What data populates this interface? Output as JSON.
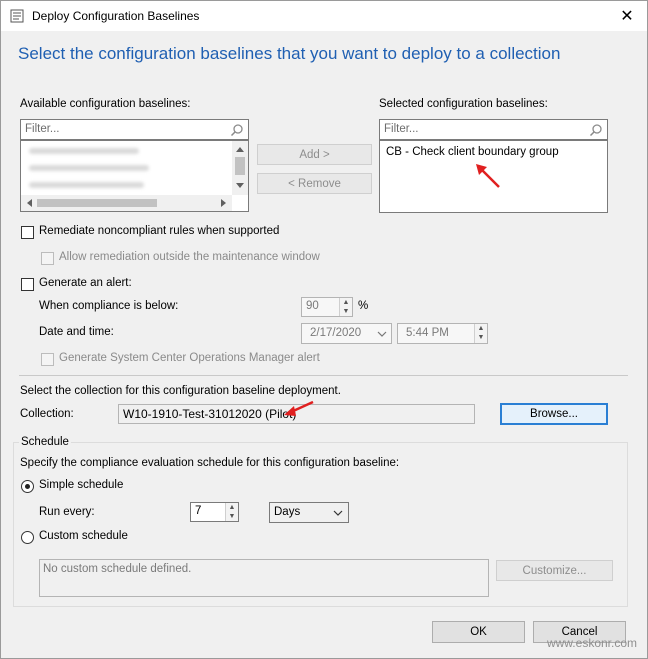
{
  "window": {
    "title": "Deploy Configuration Baselines",
    "close_glyph": "✕"
  },
  "heading": "Select the configuration baselines that you want to deploy to a collection",
  "available": {
    "label": "Available configuration baselines:",
    "filter_placeholder": "Filter..."
  },
  "selected": {
    "label": "Selected configuration baselines:",
    "filter_placeholder": "Filter...",
    "items": [
      "CB - Check client boundary group"
    ]
  },
  "buttons": {
    "add": "Add >",
    "remove": "< Remove",
    "browse": "Browse...",
    "customize": "Customize...",
    "ok": "OK",
    "cancel": "Cancel"
  },
  "options": {
    "remediate": "Remediate noncompliant rules when supported",
    "allow_remediation": "Allow remediation outside the maintenance window",
    "generate_alert": "Generate an alert:",
    "compliance_below_label": "When compliance is below:",
    "compliance_value": "90",
    "percent": "%",
    "date_time_label": "Date and time:",
    "date_value": "2/17/2020",
    "time_value": "5:44 PM",
    "scom_alert": "Generate System Center Operations Manager alert"
  },
  "collection": {
    "prompt": "Select the collection for this configuration baseline deployment.",
    "label": "Collection:",
    "value": "W10-1910-Test-31012020 (Pilot)"
  },
  "schedule": {
    "group_label": "Schedule",
    "description": "Specify the compliance evaluation schedule for this configuration baseline:",
    "simple_label": "Simple schedule",
    "run_every_label": "Run every:",
    "run_every_value": "7",
    "unit_value": "Days",
    "custom_label": "Custom schedule",
    "custom_text": "No custom schedule defined."
  },
  "watermark": "www.eskonr.com",
  "colors": {
    "heading": "#1f5fb2",
    "annotation_arrow": "#e02020",
    "default_button_border": "#2a7fd4"
  }
}
